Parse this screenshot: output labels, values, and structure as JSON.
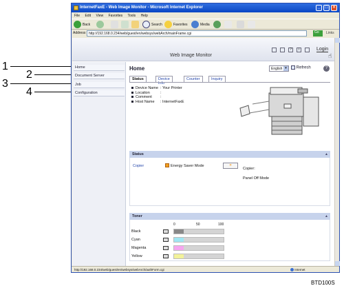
{
  "window": {
    "title": "InternetFaxE - Web Image Monitor - Microsoft Internet Explorer",
    "menu": [
      "File",
      "Edit",
      "View",
      "Favorites",
      "Tools",
      "Help"
    ],
    "toolbar": {
      "back": "Back",
      "search": "Search",
      "favorites": "Favorites",
      "media": "Media"
    },
    "address_label": "Address",
    "address_value": "http://192.168.0.234/web/guest/en/websys/webArch/mainFrame.cgi",
    "go_label": "Go",
    "links_label": "Links",
    "status_url": "http://192.168.0.234/web/guest/en/websys/webArch/authForm.cgi",
    "status_zone": "Internet"
  },
  "page": {
    "header_title": "Web Image Monitor",
    "login_label": "Login",
    "sidebar": [
      "Home",
      "Document Server",
      "Job",
      "Configuration"
    ],
    "main_title": "Home",
    "language": "English",
    "refresh_label": "Refresh",
    "help_glyph": "?",
    "tabs": [
      "Status",
      "Device Info",
      "Counter",
      "Inquiry"
    ],
    "device": {
      "labels": [
        "Device Name",
        "Location",
        "Comment",
        "Host Name"
      ],
      "values": [
        ": Your Printer",
        ":",
        ":",
        ": InternetFaxE"
      ]
    },
    "status_panel": {
      "title": "Status",
      "copier_link": "Copier",
      "energy_mode": "Energy Saver Mode",
      "copier_label": "Copier:",
      "panel_state": "Panel Off Mode"
    },
    "toner_panel": {
      "title": "Toner",
      "scale": [
        "0",
        "50",
        "100"
      ],
      "rows": [
        {
          "name": "Black",
          "color": "#888888",
          "level": 0.2
        },
        {
          "name": "Cyan",
          "color": "#9fe6f2",
          "level": 0.2
        },
        {
          "name": "Magenta",
          "color": "#f5a6f0",
          "level": 0.2
        },
        {
          "name": "Yellow",
          "color": "#f2f29a",
          "level": 0.2
        }
      ]
    }
  },
  "callouts": [
    "1",
    "2",
    "3",
    "4"
  ],
  "figure_id": "BTD100S"
}
